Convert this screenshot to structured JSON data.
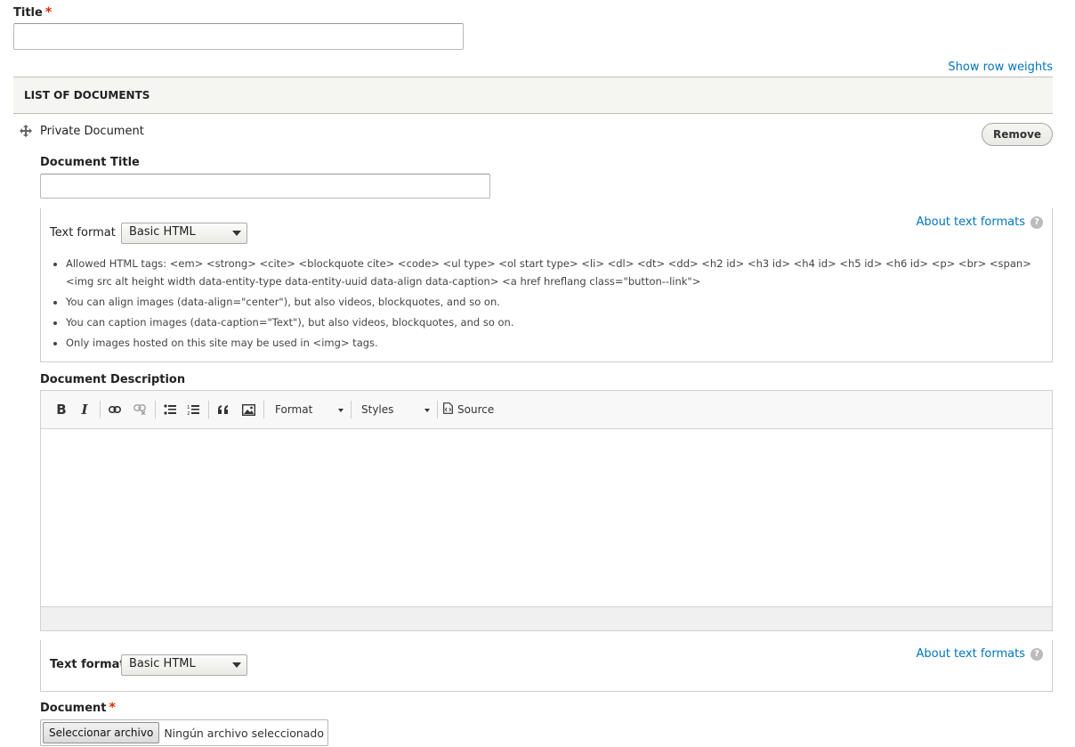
{
  "title_field": {
    "label": "Title",
    "required_mark": "*",
    "value": ""
  },
  "show_row_weights": "Show row weights",
  "table": {
    "header": "List of documents"
  },
  "row": {
    "label": "Private Document",
    "remove_label": "Remove"
  },
  "document_title": {
    "label": "Document Title",
    "value": ""
  },
  "format1": {
    "label": "Text format",
    "selected": "Basic HTML",
    "about_link": "About text formats",
    "help_icon": "?",
    "tips": [
      "Allowed HTML tags: <em> <strong> <cite> <blockquote cite> <code> <ul type> <ol start type> <li> <dl> <dt> <dd> <h2 id> <h3 id> <h4 id> <h5 id> <h6 id> <p> <br> <span> <img src alt height width data-entity-type data-entity-uuid data-align data-caption> <a href hreflang class=\"button--link\">",
      "You can align images (data-align=\"center\"), but also videos, blockquotes, and so on.",
      "You can caption images (data-caption=\"Text\"), but also videos, blockquotes, and so on.",
      "Only images hosted on this site may be used in <img> tags."
    ]
  },
  "description": {
    "label": "Document Description",
    "toolbar": {
      "bold": "B",
      "italic": "I",
      "format_combo": "Format",
      "styles_combo": "Styles",
      "source": "Source"
    }
  },
  "format2": {
    "label": "Text format",
    "selected": "Basic HTML",
    "about_link": "About text formats",
    "help_icon": "?"
  },
  "document_file": {
    "label": "Document",
    "required_mark": "*",
    "button": "Seleccionar archivo",
    "status": "Ningún archivo seleccionado"
  }
}
